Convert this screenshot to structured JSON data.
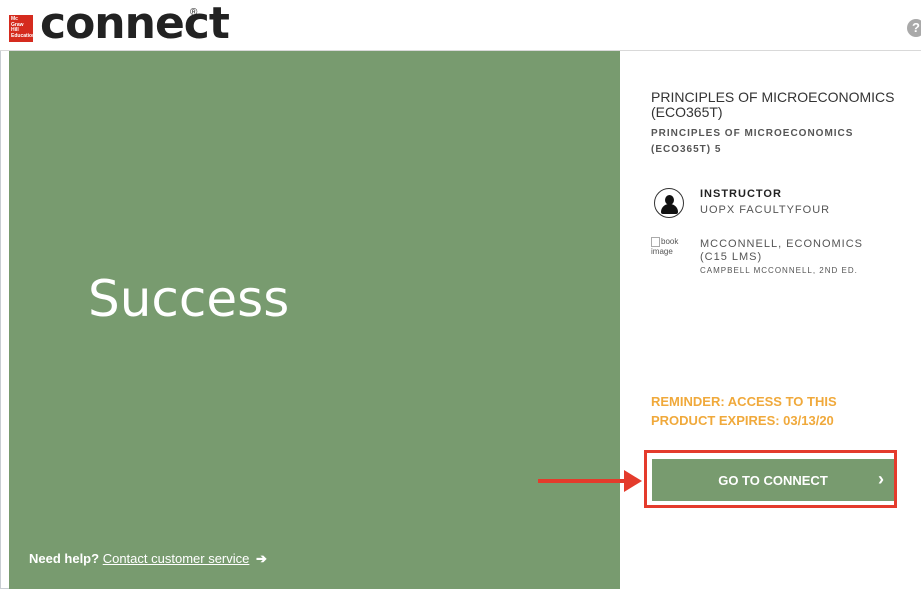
{
  "header": {
    "logo_lines": [
      "Mc",
      "Graw",
      "Hill",
      "Education"
    ],
    "brand": "connect",
    "registered": "®",
    "help_icon_label": "?"
  },
  "hero": {
    "title": "Success",
    "need_help": "Need help?",
    "contact_link": "Contact customer service",
    "contact_arrow": "➔"
  },
  "course": {
    "name": "PRINCIPLES OF MICROECONOMICS (ECO365T)",
    "section": "PRINCIPLES OF MICROECONOMICS (ECO365T) 5"
  },
  "instructor": {
    "label": "INSTRUCTOR",
    "name": "UOPX FACULTYFOUR",
    "icon": "user-icon"
  },
  "book": {
    "image_alt": "book image",
    "title": "MCCONNELL, ECONOMICS (C15 LMS)",
    "author": "CAMPBELL MCCONNELL, 2ND ED."
  },
  "reminder": "REMINDER: ACCESS TO THIS PRODUCT EXPIRES: 03/13/20",
  "cta": {
    "label": "GO TO CONNECT",
    "chevron": "›"
  },
  "colors": {
    "green": "#789b6f",
    "reminder": "#f0a93b",
    "annotation": "#e43b2c",
    "brand_red": "#d52b1e"
  }
}
